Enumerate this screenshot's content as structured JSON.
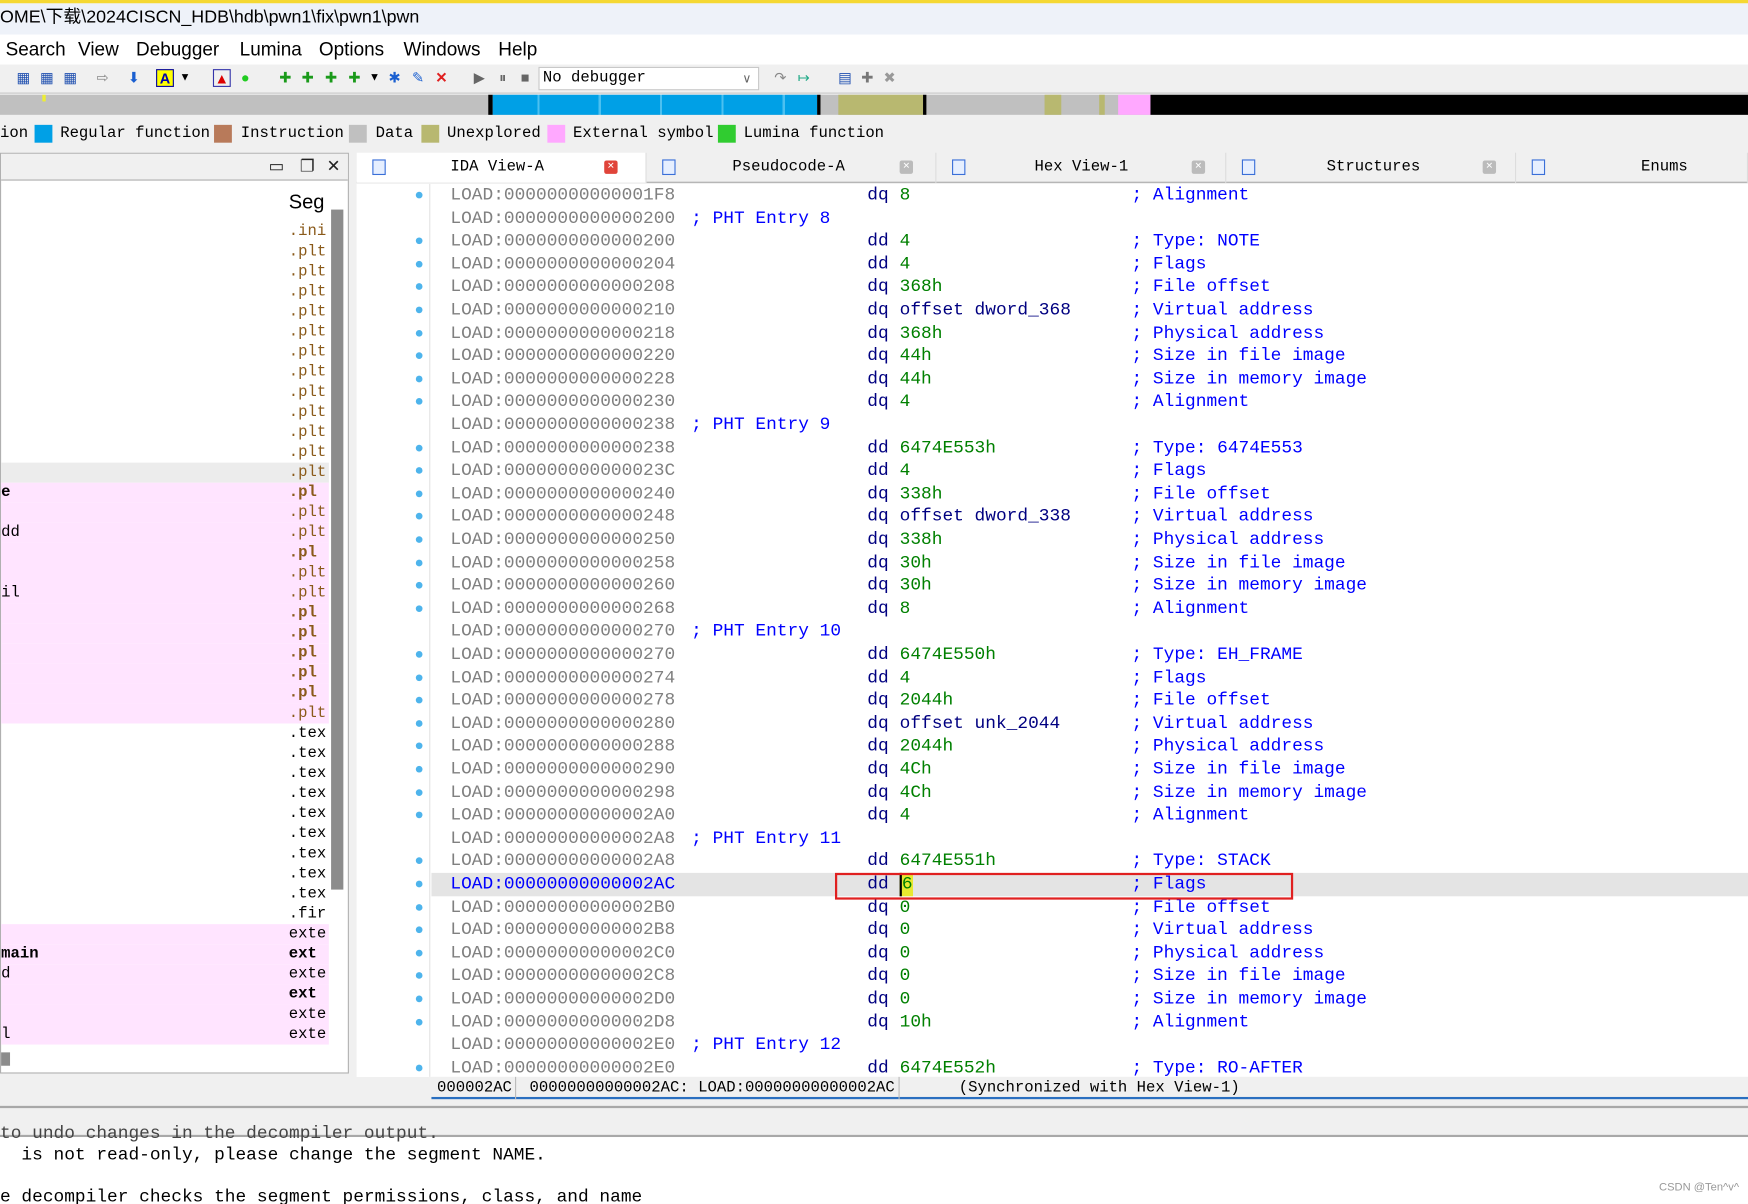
{
  "title": "OME\\下载\\2024CISCN_HDB\\hdb\\pwn1\\fix\\pwn1\\pwn",
  "menu": [
    "Search",
    "View",
    "Debugger",
    "Lumina",
    "Options",
    "Windows",
    "Help"
  ],
  "toolbar": {
    "debugger_select": "No debugger"
  },
  "legend": [
    {
      "label": "ion",
      "color": ""
    },
    {
      "label": "Regular function",
      "color": "#00a0e6"
    },
    {
      "label": "Instruction",
      "color": "#b87a5a"
    },
    {
      "label": "Data",
      "color": "#c0c0c0"
    },
    {
      "label": "Unexplored",
      "color": "#b8b870"
    },
    {
      "label": "External symbol",
      "color": "#ffa8ff"
    },
    {
      "label": "Lumina function",
      "color": "#30cc30"
    }
  ],
  "left_panel": {
    "column_header": "Seg",
    "rows": [
      {
        "name": "",
        "seg": ".ini"
      },
      {
        "name": "",
        "seg": ".plt"
      },
      {
        "name": "",
        "seg": ".plt"
      },
      {
        "name": "",
        "seg": ".plt"
      },
      {
        "name": "",
        "seg": ".plt"
      },
      {
        "name": "",
        "seg": ".plt"
      },
      {
        "name": "",
        "seg": ".plt"
      },
      {
        "name": "",
        "seg": ".plt"
      },
      {
        "name": "",
        "seg": ".plt"
      },
      {
        "name": "",
        "seg": ".plt"
      },
      {
        "name": "",
        "seg": ".plt"
      },
      {
        "name": "",
        "seg": ".plt"
      },
      {
        "name": "",
        "seg": ".plt"
      },
      {
        "name": "e",
        "seg": ".pl",
        "bold": true,
        "pink": true
      },
      {
        "name": "",
        "seg": ".plt",
        "pink": true
      },
      {
        "name": "dd",
        "seg": ".plt",
        "pink": true
      },
      {
        "name": "",
        "seg": ".pl",
        "bold": true,
        "pink": true
      },
      {
        "name": "",
        "seg": ".plt",
        "pink": true
      },
      {
        "name": "il",
        "seg": ".plt",
        "pink": true
      },
      {
        "name": "",
        "seg": ".pl",
        "bold": true,
        "pink": true
      },
      {
        "name": "",
        "seg": ".pl",
        "bold": true,
        "pink": true
      },
      {
        "name": "",
        "seg": ".pl",
        "bold": true,
        "pink": true
      },
      {
        "name": "",
        "seg": ".pl",
        "bold": true,
        "pink": true
      },
      {
        "name": "",
        "seg": ".pl",
        "bold": true,
        "pink": true
      },
      {
        "name": "",
        "seg": ".plt",
        "pink": true
      },
      {
        "name": "",
        "seg": ".tex"
      },
      {
        "name": "",
        "seg": ".tex"
      },
      {
        "name": "",
        "seg": ".tex"
      },
      {
        "name": "",
        "seg": ".tex"
      },
      {
        "name": "",
        "seg": ".tex"
      },
      {
        "name": "",
        "seg": ".tex"
      },
      {
        "name": "",
        "seg": ".tex"
      },
      {
        "name": "",
        "seg": ".tex"
      },
      {
        "name": "",
        "seg": ".tex"
      },
      {
        "name": "",
        "seg": ".fir"
      },
      {
        "name": "",
        "seg": "exte",
        "pink": true
      },
      {
        "name": "main",
        "seg": "ext",
        "bold": true,
        "pink": true
      },
      {
        "name": "d",
        "seg": "exte",
        "pink": true
      },
      {
        "name": "",
        "seg": "ext",
        "bold": true,
        "pink": true
      },
      {
        "name": "",
        "seg": "exte",
        "pink": true
      },
      {
        "name": "l",
        "seg": "exte",
        "pink": true
      }
    ]
  },
  "tabs": [
    {
      "label": "IDA View-A",
      "active": true
    },
    {
      "label": "Pseudocode-A"
    },
    {
      "label": "Hex View-1"
    },
    {
      "label": "Structures"
    },
    {
      "label": "Enums"
    }
  ],
  "listing": [
    {
      "addr": "LOAD:00000000000001F8",
      "mn": "dq",
      "op": "8",
      "cm": "; Alignment"
    },
    {
      "addr": "LOAD:0000000000000200",
      "header": "; PHT Entry 8"
    },
    {
      "addr": "LOAD:0000000000000200",
      "mn": "dd",
      "op": "4",
      "cm": "; Type: NOTE"
    },
    {
      "addr": "LOAD:0000000000000204",
      "mn": "dd",
      "op": "4",
      "cm": "; Flags"
    },
    {
      "addr": "LOAD:0000000000000208",
      "mn": "dq",
      "op": "368h",
      "cm": "; File offset"
    },
    {
      "addr": "LOAD:0000000000000210",
      "mn": "dq",
      "op": "offset dword_368",
      "name": true,
      "cm": "; Virtual address"
    },
    {
      "addr": "LOAD:0000000000000218",
      "mn": "dq",
      "op": "368h",
      "cm": "; Physical address"
    },
    {
      "addr": "LOAD:0000000000000220",
      "mn": "dq",
      "op": "44h",
      "cm": "; Size in file image"
    },
    {
      "addr": "LOAD:0000000000000228",
      "mn": "dq",
      "op": "44h",
      "cm": "; Size in memory image"
    },
    {
      "addr": "LOAD:0000000000000230",
      "mn": "dq",
      "op": "4",
      "cm": "; Alignment"
    },
    {
      "addr": "LOAD:0000000000000238",
      "header": "; PHT Entry 9"
    },
    {
      "addr": "LOAD:0000000000000238",
      "mn": "dd",
      "op": "6474E553h",
      "cm": "; Type: 6474E553"
    },
    {
      "addr": "LOAD:000000000000023C",
      "mn": "dd",
      "op": "4",
      "cm": "; Flags"
    },
    {
      "addr": "LOAD:0000000000000240",
      "mn": "dq",
      "op": "338h",
      "cm": "; File offset"
    },
    {
      "addr": "LOAD:0000000000000248",
      "mn": "dq",
      "op": "offset dword_338",
      "name": true,
      "cm": "; Virtual address"
    },
    {
      "addr": "LOAD:0000000000000250",
      "mn": "dq",
      "op": "338h",
      "cm": "; Physical address"
    },
    {
      "addr": "LOAD:0000000000000258",
      "mn": "dq",
      "op": "30h",
      "cm": "; Size in file image"
    },
    {
      "addr": "LOAD:0000000000000260",
      "mn": "dq",
      "op": "30h",
      "cm": "; Size in memory image"
    },
    {
      "addr": "LOAD:0000000000000268",
      "mn": "dq",
      "op": "8",
      "cm": "; Alignment"
    },
    {
      "addr": "LOAD:0000000000000270",
      "header": "; PHT Entry 10"
    },
    {
      "addr": "LOAD:0000000000000270",
      "mn": "dd",
      "op": "6474E550h",
      "cm": "; Type: EH_FRAME"
    },
    {
      "addr": "LOAD:0000000000000274",
      "mn": "dd",
      "op": "4",
      "cm": "; Flags"
    },
    {
      "addr": "LOAD:0000000000000278",
      "mn": "dq",
      "op": "2044h",
      "cm": "; File offset"
    },
    {
      "addr": "LOAD:0000000000000280",
      "mn": "dq",
      "op": "offset unk_2044",
      "name": true,
      "cm": "; Virtual address"
    },
    {
      "addr": "LOAD:0000000000000288",
      "mn": "dq",
      "op": "2044h",
      "cm": "; Physical address"
    },
    {
      "addr": "LOAD:0000000000000290",
      "mn": "dq",
      "op": "4Ch",
      "cm": "; Size in file image"
    },
    {
      "addr": "LOAD:0000000000000298",
      "mn": "dq",
      "op": "4Ch",
      "cm": "; Size in memory image"
    },
    {
      "addr": "LOAD:00000000000002A0",
      "mn": "dq",
      "op": "4",
      "cm": "; Alignment"
    },
    {
      "addr": "LOAD:00000000000002A8",
      "header": "; PHT Entry 11"
    },
    {
      "addr": "LOAD:00000000000002A8",
      "mn": "dd",
      "op": "6474E551h",
      "cm": "; Type: STACK"
    },
    {
      "addr": "LOAD:00000000000002AC",
      "mn": "dd",
      "op": "6",
      "cm": "; Flags",
      "selected": true
    },
    {
      "addr": "LOAD:00000000000002B0",
      "mn": "dq",
      "op": "0",
      "cm": "; File offset"
    },
    {
      "addr": "LOAD:00000000000002B8",
      "mn": "dq",
      "op": "0",
      "cm": "; Virtual address"
    },
    {
      "addr": "LOAD:00000000000002C0",
      "mn": "dq",
      "op": "0",
      "cm": "; Physical address"
    },
    {
      "addr": "LOAD:00000000000002C8",
      "mn": "dq",
      "op": "0",
      "cm": "; Size in file image"
    },
    {
      "addr": "LOAD:00000000000002D0",
      "mn": "dq",
      "op": "0",
      "cm": "; Size in memory image"
    },
    {
      "addr": "LOAD:00000000000002D8",
      "mn": "dq",
      "op": "10h",
      "cm": "; Alignment"
    },
    {
      "addr": "LOAD:00000000000002E0",
      "header": "; PHT Entry 12"
    },
    {
      "addr": "LOAD:00000000000002E0",
      "mn": "dd",
      "op": "6474E552h",
      "cm": "; Type: RO-AFTER"
    }
  ],
  "listing_status": [
    "000002AC",
    "00000000000002AC: LOAD:00000000000002AC",
    "(Synchronized with Hex View-1)"
  ],
  "output": [
    "to undo changes in the decompiler output.",
    "  is not read-only, please change the segment NAME.",
    "e decompiler checks the segment permissions, class, and name"
  ],
  "watermark": "CSDN @Ten^v^"
}
